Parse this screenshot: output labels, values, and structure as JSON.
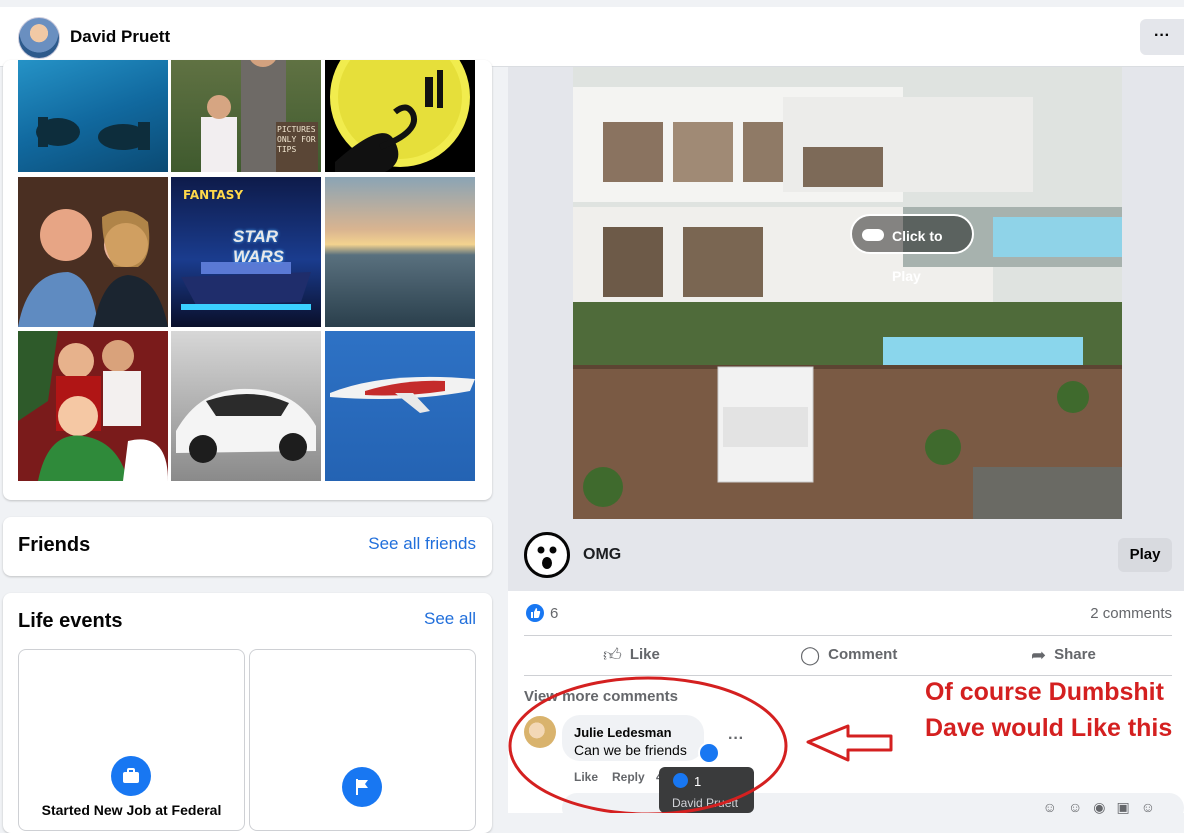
{
  "header": {
    "profile_name": "David Pruett",
    "more_label": "···"
  },
  "photos": [
    {
      "name": "scuba-divers-photo"
    },
    {
      "name": "family-sign-photo"
    },
    {
      "name": "moon-silhouette-photo"
    },
    {
      "name": "couple-photo"
    },
    {
      "name": "cruise-ship-photo"
    },
    {
      "name": "sunset-ocean-photo"
    },
    {
      "name": "kids-christmas-photo"
    },
    {
      "name": "white-sports-car-photo"
    },
    {
      "name": "jet-plane-photo"
    }
  ],
  "photo_sign_text": "PICTURES ONLY FOR TIPS",
  "cruise_text": "STAR WARS",
  "friends": {
    "title": "Friends",
    "link": "See all friends"
  },
  "life_events": {
    "title": "Life events",
    "link": "See all",
    "items": [
      {
        "label": "Started New Job at Federal"
      },
      {
        "label": ""
      }
    ]
  },
  "post": {
    "click_to_play": "Click to Play",
    "game_title": "OMG",
    "play_label": "Play",
    "like_count": "6",
    "comment_count": "2 comments",
    "actions": {
      "like": "Like",
      "comment": "Comment",
      "share": "Share"
    },
    "view_more": "View more comments",
    "comment": {
      "author": "Julie Ledesman",
      "text": "Can we be friends",
      "like": "Like",
      "reply": "Reply",
      "time": "4d"
    },
    "tooltip": {
      "count": "1",
      "name": "David Pruett"
    },
    "more_label": "···"
  },
  "annotation": {
    "line1": "Of course Dumbshit",
    "line2": "Dave would Like this",
    "color": "#d42020"
  },
  "colors": {
    "accent": "#1877f2",
    "link": "#216fdb",
    "background": "#f0f2f5"
  }
}
